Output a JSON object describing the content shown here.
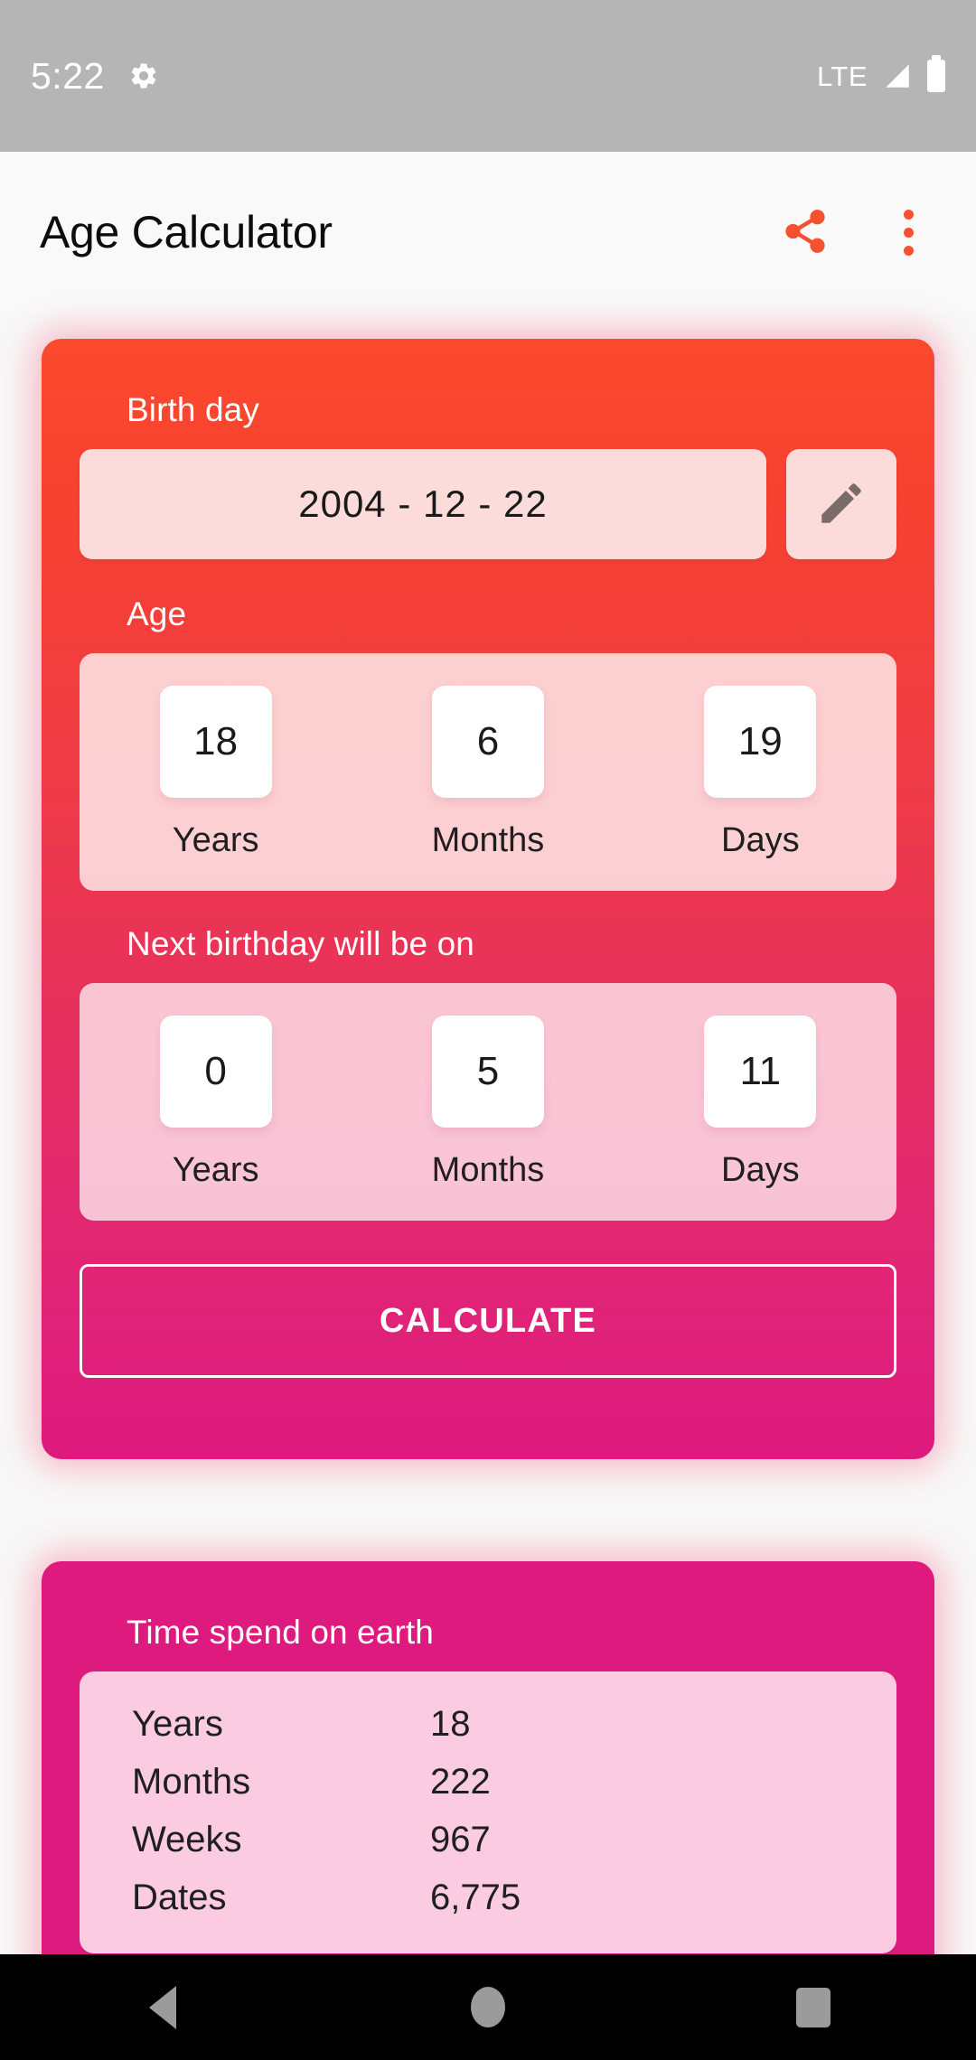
{
  "status_bar": {
    "time": "5:22",
    "settings_icon": "gear-icon",
    "network": "LTE",
    "signal_icon": "signal-triangle-icon",
    "battery_icon": "battery-full-icon"
  },
  "app_bar": {
    "title": "Age Calculator",
    "share_icon": "share-icon",
    "overflow_icon": "more-vertical-icon"
  },
  "age_card": {
    "birthday_label": "Birth day",
    "birthday_value": "2004 - 12 - 22",
    "edit_icon": "pencil-edit-icon",
    "age_label": "Age",
    "age_stats": [
      {
        "value": "18",
        "label": "Years"
      },
      {
        "value": "6",
        "label": "Months"
      },
      {
        "value": "19",
        "label": "Days"
      }
    ],
    "next_birthday_label": "Next birthday will be on",
    "next_birthday_stats": [
      {
        "value": "0",
        "label": "Years"
      },
      {
        "value": "5",
        "label": "Months"
      },
      {
        "value": "11",
        "label": "Days"
      }
    ],
    "calculate_label": "CALCULATE"
  },
  "earth_card": {
    "title": "Time spend on earth",
    "rows": [
      {
        "name": "Years",
        "value": "18"
      },
      {
        "name": "Months",
        "value": "222"
      },
      {
        "name": "Weeks",
        "value": "967"
      },
      {
        "name": "Dates",
        "value": "6,775"
      }
    ]
  },
  "nav_bar": {
    "back_icon": "back-triangle-icon",
    "home_icon": "home-circle-icon",
    "recents_icon": "recents-square-icon"
  },
  "colors": {
    "accent_orange": "#f4522f",
    "card_top": "#fb4a2e",
    "card_bottom": "#de1a7e",
    "status_bar_bg": "#b5b5b5",
    "app_bar_bg": "#f9f9f9",
    "page_bg": "#f8f8f8"
  }
}
